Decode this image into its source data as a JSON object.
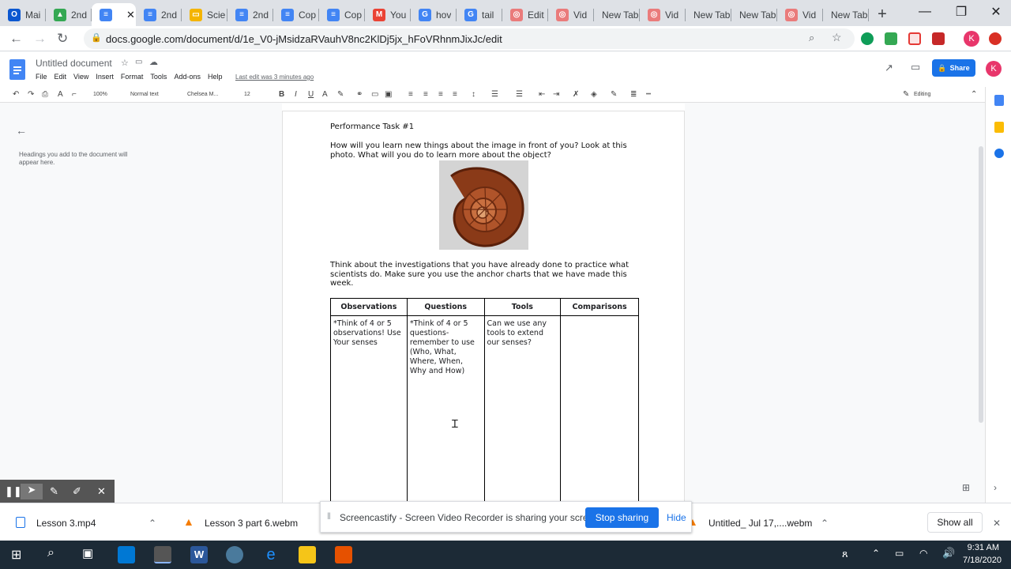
{
  "tabs": [
    {
      "label": "Mai",
      "color": "#0b57d0",
      "glyph": "O"
    },
    {
      "label": "2nd",
      "color": "#34a853",
      "glyph": "▲"
    },
    {
      "label": "",
      "color": "#4285f4",
      "glyph": "≡",
      "active": true
    },
    {
      "label": "2nd",
      "color": "#4285f4",
      "glyph": "≡"
    },
    {
      "label": "Scie",
      "color": "#f4b400",
      "glyph": "▭"
    },
    {
      "label": "2nd",
      "color": "#4285f4",
      "glyph": "≡"
    },
    {
      "label": "Cop",
      "color": "#4285f4",
      "glyph": "≡"
    },
    {
      "label": "Cop",
      "color": "#4285f4",
      "glyph": "≡"
    },
    {
      "label": "You",
      "color": "#ea4335",
      "glyph": "M"
    },
    {
      "label": "hov",
      "color": "#4285f4",
      "glyph": "G"
    },
    {
      "label": "tail",
      "color": "#4285f4",
      "glyph": "G"
    },
    {
      "label": "Edit",
      "color": "#ea7b7b",
      "glyph": "◎"
    },
    {
      "label": "Vid",
      "color": "#ea7b7b",
      "glyph": "◎"
    },
    {
      "label": "New Tab",
      "color": "",
      "glyph": ""
    },
    {
      "label": "Vid",
      "color": "#ea7b7b",
      "glyph": "◎"
    },
    {
      "label": "New Tab",
      "color": "",
      "glyph": ""
    },
    {
      "label": "New Tab",
      "color": "",
      "glyph": ""
    },
    {
      "label": "Vid",
      "color": "#ea7b7b",
      "glyph": "◎"
    },
    {
      "label": "New Tab",
      "color": "",
      "glyph": ""
    }
  ],
  "address": {
    "url": "docs.google.com/document/d/1e_V0-jMsidzaRVauhV8nc2KlDj5jx_hFoVRhnmJixJc/edit"
  },
  "doc": {
    "title": "Untitled document",
    "menus": [
      "File",
      "Edit",
      "View",
      "Insert",
      "Format",
      "Tools",
      "Add-ons",
      "Help"
    ],
    "last_edit": "Last edit was 3 minutes ago",
    "share": "Share",
    "avatar": "K"
  },
  "toolbar": {
    "zoom": "100%",
    "style": "Normal text",
    "font": "Chelsea M...",
    "size": "12",
    "mode": "Editing"
  },
  "sidebar": {
    "note": "Headings you add to the document will appear here."
  },
  "page": {
    "heading": "Performance Task #1",
    "prompt": "How will you learn new things about the image in front of you?  Look at this photo.  What will you do to learn more about the object?",
    "instructions": "Think about the investigations that you have already done to practice what scientists do.  Make sure you use the anchor charts that we have made this week.",
    "table": {
      "headers": [
        "Observations",
        "Questions",
        "Tools",
        "Comparisons"
      ],
      "cells": [
        "*Think of 4 or 5 observations! Use Your senses",
        "*Think of 4 or 5 questions- remember to use (Who, What, Where, When, Why and How)",
        "Can we use any tools to extend our senses?",
        ""
      ]
    }
  },
  "downloads": {
    "items": [
      "Lesson 3.mp4",
      "Lesson 3 part 6.webm",
      "Untitled_ Jul 17,....webm"
    ],
    "show_all": "Show all"
  },
  "banner": {
    "text": "Screencastify - Screen Video Recorder is sharing your screen.",
    "stop": "Stop sharing",
    "hide": "Hide"
  },
  "taskbar": {
    "time": "9:31 AM",
    "date": "7/18/2020"
  }
}
